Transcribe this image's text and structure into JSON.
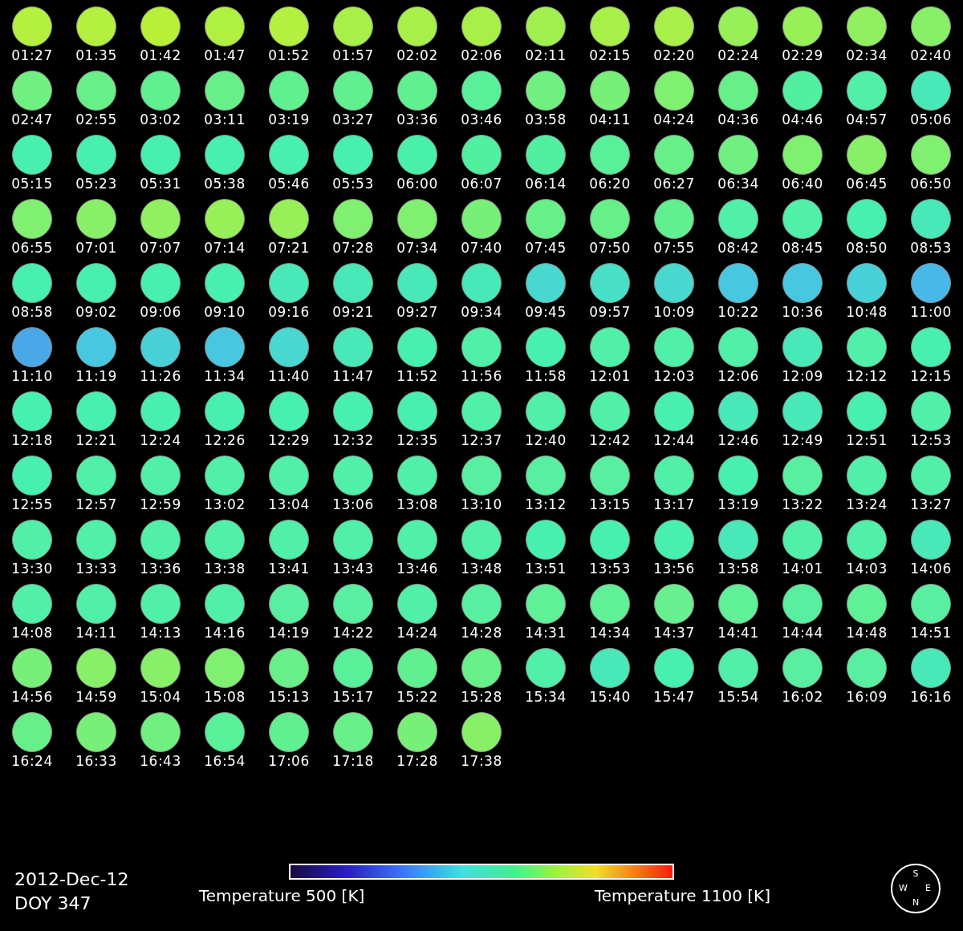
{
  "disks": [
    {
      "time": "01:27",
      "color": "#b4f040"
    },
    {
      "time": "01:35",
      "color": "#b4f040"
    },
    {
      "time": "01:42",
      "color": "#b8f038"
    },
    {
      "time": "01:47",
      "color": "#b0f040"
    },
    {
      "time": "01:52",
      "color": "#b4f040"
    },
    {
      "time": "01:57",
      "color": "#a8f048"
    },
    {
      "time": "02:02",
      "color": "#a8f048"
    },
    {
      "time": "02:06",
      "color": "#a8f048"
    },
    {
      "time": "02:11",
      "color": "#a0f050"
    },
    {
      "time": "02:15",
      "color": "#a8f048"
    },
    {
      "time": "02:20",
      "color": "#a8f048"
    },
    {
      "time": "02:24",
      "color": "#98f058"
    },
    {
      "time": "02:29",
      "color": "#98f058"
    },
    {
      "time": "02:34",
      "color": "#90f060"
    },
    {
      "time": "02:40",
      "color": "#88f068"
    },
    {
      "time": "02:47",
      "color": "#70f080"
    },
    {
      "time": "02:55",
      "color": "#68f088"
    },
    {
      "time": "03:02",
      "color": "#60f090"
    },
    {
      "time": "03:11",
      "color": "#68f088"
    },
    {
      "time": "03:19",
      "color": "#60f090"
    },
    {
      "time": "03:27",
      "color": "#60f090"
    },
    {
      "time": "03:36",
      "color": "#60f090"
    },
    {
      "time": "03:46",
      "color": "#58f098"
    },
    {
      "time": "03:58",
      "color": "#70f080"
    },
    {
      "time": "04:11",
      "color": "#78f078"
    },
    {
      "time": "04:24",
      "color": "#80f070"
    },
    {
      "time": "04:36",
      "color": "#68f088"
    },
    {
      "time": "04:46",
      "color": "#50f0a0"
    },
    {
      "time": "04:57",
      "color": "#50f0a8"
    },
    {
      "time": "05:06",
      "color": "#48e8b8"
    },
    {
      "time": "05:15",
      "color": "#48f0b0"
    },
    {
      "time": "05:23",
      "color": "#48f0b0"
    },
    {
      "time": "05:31",
      "color": "#48f0b0"
    },
    {
      "time": "05:38",
      "color": "#48f0b0"
    },
    {
      "time": "05:46",
      "color": "#48f0b0"
    },
    {
      "time": "05:53",
      "color": "#48f0b0"
    },
    {
      "time": "06:00",
      "color": "#48f0a8"
    },
    {
      "time": "06:07",
      "color": "#50f0a0"
    },
    {
      "time": "06:14",
      "color": "#50f0a0"
    },
    {
      "time": "06:20",
      "color": "#58f098"
    },
    {
      "time": "06:27",
      "color": "#68f088"
    },
    {
      "time": "06:34",
      "color": "#70f080"
    },
    {
      "time": "06:40",
      "color": "#80f070"
    },
    {
      "time": "06:45",
      "color": "#88f068"
    },
    {
      "time": "06:50",
      "color": "#80f070"
    },
    {
      "time": "06:55",
      "color": "#80f070"
    },
    {
      "time": "07:01",
      "color": "#88f068"
    },
    {
      "time": "07:07",
      "color": "#90f060"
    },
    {
      "time": "07:14",
      "color": "#98f058"
    },
    {
      "time": "07:21",
      "color": "#98f058"
    },
    {
      "time": "07:28",
      "color": "#80f070"
    },
    {
      "time": "07:34",
      "color": "#80f070"
    },
    {
      "time": "07:40",
      "color": "#78f078"
    },
    {
      "time": "07:45",
      "color": "#68f088"
    },
    {
      "time": "07:50",
      "color": "#68f088"
    },
    {
      "time": "07:55",
      "color": "#60f090"
    },
    {
      "time": "08:42",
      "color": "#50f0a8"
    },
    {
      "time": "08:45",
      "color": "#50f0a8"
    },
    {
      "time": "08:50",
      "color": "#48f0b0"
    },
    {
      "time": "08:53",
      "color": "#48e8b8"
    },
    {
      "time": "08:58",
      "color": "#48f0b0"
    },
    {
      "time": "09:02",
      "color": "#48f0b0"
    },
    {
      "time": "09:06",
      "color": "#48f0b0"
    },
    {
      "time": "09:10",
      "color": "#48f0b0"
    },
    {
      "time": "09:16",
      "color": "#48e8b8"
    },
    {
      "time": "09:21",
      "color": "#48e8b8"
    },
    {
      "time": "09:27",
      "color": "#48e8b8"
    },
    {
      "time": "09:34",
      "color": "#48e8b8"
    },
    {
      "time": "09:45",
      "color": "#48d8d0"
    },
    {
      "time": "09:57",
      "color": "#48e0c8"
    },
    {
      "time": "10:09",
      "color": "#48d8d0"
    },
    {
      "time": "10:22",
      "color": "#48c8e0"
    },
    {
      "time": "10:36",
      "color": "#48c8e0"
    },
    {
      "time": "10:48",
      "color": "#48d0d8"
    },
    {
      "time": "11:00",
      "color": "#48b8e8"
    },
    {
      "time": "11:10",
      "color": "#48a8e8"
    },
    {
      "time": "11:19",
      "color": "#48c8e0"
    },
    {
      "time": "11:26",
      "color": "#48d0d8"
    },
    {
      "time": "11:34",
      "color": "#48c8e0"
    },
    {
      "time": "11:40",
      "color": "#48d8d0"
    },
    {
      "time": "11:47",
      "color": "#48e8b8"
    },
    {
      "time": "11:52",
      "color": "#48f0b0"
    },
    {
      "time": "11:56",
      "color": "#50f0a8"
    },
    {
      "time": "11:58",
      "color": "#48f0b0"
    },
    {
      "time": "12:01",
      "color": "#50f0a8"
    },
    {
      "time": "12:03",
      "color": "#50f0a8"
    },
    {
      "time": "12:06",
      "color": "#50f0a8"
    },
    {
      "time": "12:09",
      "color": "#48e8b8"
    },
    {
      "time": "12:12",
      "color": "#50f0a8"
    },
    {
      "time": "12:15",
      "color": "#48f0b0"
    },
    {
      "time": "12:18",
      "color": "#48f0b0"
    },
    {
      "time": "12:21",
      "color": "#48f0b0"
    },
    {
      "time": "12:24",
      "color": "#48f0b0"
    },
    {
      "time": "12:26",
      "color": "#48f0b0"
    },
    {
      "time": "12:29",
      "color": "#48f0b0"
    },
    {
      "time": "12:32",
      "color": "#48f0b0"
    },
    {
      "time": "12:35",
      "color": "#48f0b0"
    },
    {
      "time": "12:37",
      "color": "#50f0a8"
    },
    {
      "time": "12:40",
      "color": "#50f0a8"
    },
    {
      "time": "12:42",
      "color": "#50f0a8"
    },
    {
      "time": "12:44",
      "color": "#48f0b0"
    },
    {
      "time": "12:46",
      "color": "#48e8b8"
    },
    {
      "time": "12:49",
      "color": "#48e8b8"
    },
    {
      "time": "12:51",
      "color": "#48f0b0"
    },
    {
      "time": "12:53",
      "color": "#50f0a8"
    },
    {
      "time": "12:55",
      "color": "#48f0b0"
    },
    {
      "time": "12:57",
      "color": "#50f0a8"
    },
    {
      "time": "12:59",
      "color": "#50f0a8"
    },
    {
      "time": "13:02",
      "color": "#50f0a8"
    },
    {
      "time": "13:04",
      "color": "#50f0a8"
    },
    {
      "time": "13:06",
      "color": "#50f0a8"
    },
    {
      "time": "13:08",
      "color": "#50f0a8"
    },
    {
      "time": "13:10",
      "color": "#58f0a0"
    },
    {
      "time": "13:12",
      "color": "#58f0a0"
    },
    {
      "time": "13:15",
      "color": "#58f0a0"
    },
    {
      "time": "13:17",
      "color": "#50f0a8"
    },
    {
      "time": "13:19",
      "color": "#48f0b0"
    },
    {
      "time": "13:22",
      "color": "#58f0a0"
    },
    {
      "time": "13:24",
      "color": "#50f0a8"
    },
    {
      "time": "13:27",
      "color": "#50f0a8"
    },
    {
      "time": "13:30",
      "color": "#50f0a8"
    },
    {
      "time": "13:33",
      "color": "#50f0a8"
    },
    {
      "time": "13:36",
      "color": "#50f0a8"
    },
    {
      "time": "13:38",
      "color": "#50f0a8"
    },
    {
      "time": "13:41",
      "color": "#50f0a8"
    },
    {
      "time": "13:43",
      "color": "#50f0a8"
    },
    {
      "time": "13:46",
      "color": "#50f0a8"
    },
    {
      "time": "13:48",
      "color": "#50f0a8"
    },
    {
      "time": "13:51",
      "color": "#48f0b0"
    },
    {
      "time": "13:53",
      "color": "#48f0b0"
    },
    {
      "time": "13:56",
      "color": "#48f0b0"
    },
    {
      "time": "13:58",
      "color": "#48e8b8"
    },
    {
      "time": "14:01",
      "color": "#50f0a8"
    },
    {
      "time": "14:03",
      "color": "#50f0a8"
    },
    {
      "time": "14:06",
      "color": "#48e8b8"
    },
    {
      "time": "14:08",
      "color": "#50f0a8"
    },
    {
      "time": "14:11",
      "color": "#50f0a8"
    },
    {
      "time": "14:13",
      "color": "#50f0a8"
    },
    {
      "time": "14:16",
      "color": "#50f0a8"
    },
    {
      "time": "14:19",
      "color": "#58f0a0"
    },
    {
      "time": "14:22",
      "color": "#58f0a0"
    },
    {
      "time": "14:24",
      "color": "#50f0a8"
    },
    {
      "time": "14:28",
      "color": "#58f0a0"
    },
    {
      "time": "14:31",
      "color": "#60f098"
    },
    {
      "time": "14:34",
      "color": "#60f098"
    },
    {
      "time": "14:37",
      "color": "#68f090"
    },
    {
      "time": "14:41",
      "color": "#60f098"
    },
    {
      "time": "14:44",
      "color": "#58f0a0"
    },
    {
      "time": "14:48",
      "color": "#60f098"
    },
    {
      "time": "14:51",
      "color": "#58f0a0"
    },
    {
      "time": "14:56",
      "color": "#78f078"
    },
    {
      "time": "14:59",
      "color": "#88f068"
    },
    {
      "time": "15:04",
      "color": "#88f068"
    },
    {
      "time": "15:08",
      "color": "#80f070"
    },
    {
      "time": "15:13",
      "color": "#68f088"
    },
    {
      "time": "15:17",
      "color": "#58f098"
    },
    {
      "time": "15:22",
      "color": "#60f090"
    },
    {
      "time": "15:28",
      "color": "#68f088"
    },
    {
      "time": "15:34",
      "color": "#50f0a8"
    },
    {
      "time": "15:40",
      "color": "#48e8b8"
    },
    {
      "time": "15:47",
      "color": "#48f0b0"
    },
    {
      "time": "15:54",
      "color": "#50f0a8"
    },
    {
      "time": "16:02",
      "color": "#58f0a0"
    },
    {
      "time": "16:09",
      "color": "#58f0a0"
    },
    {
      "time": "16:16",
      "color": "#48e8b8"
    },
    {
      "time": "16:24",
      "color": "#68f088"
    },
    {
      "time": "16:33",
      "color": "#78f078"
    },
    {
      "time": "16:43",
      "color": "#70f080"
    },
    {
      "time": "16:54",
      "color": "#58f098"
    },
    {
      "time": "17:06",
      "color": "#60f090"
    },
    {
      "time": "17:18",
      "color": "#68f088"
    },
    {
      "time": "17:28",
      "color": "#78f078"
    },
    {
      "time": "17:38",
      "color": "#88f068"
    }
  ],
  "date": "2012-Dec-12",
  "doy": "DOY 347",
  "colorbar": {
    "min_label": "Temperature 500 [K]",
    "max_label": "Temperature 1100 [K]"
  },
  "compass": {
    "top": "S",
    "left": "W",
    "right": "E",
    "bottom": "N"
  }
}
